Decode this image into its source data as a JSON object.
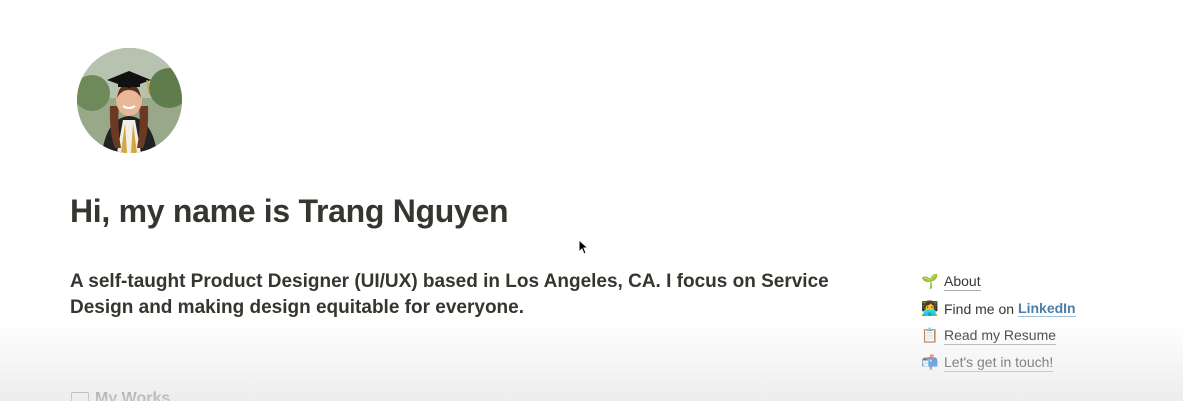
{
  "profile": {
    "avatar_icon": "graduate-photo"
  },
  "header": {
    "title": "Hi, my name is Trang Nguyen"
  },
  "intro": {
    "text": "A self-taught Product Designer (UI/UX) based in Los Angeles, CA. I focus on Service Design and making design equitable for everyone."
  },
  "side_links": [
    {
      "emoji": "🌱",
      "label": "About"
    },
    {
      "emoji": "👩‍💻",
      "prefix": "Find me on",
      "link": "LinkedIn"
    },
    {
      "emoji": "📋",
      "label": "Read my Resume"
    },
    {
      "emoji": "📬",
      "label": "Let's get in touch!"
    }
  ],
  "sections": {
    "works_heading": "My Works",
    "works_icon": "window-icon"
  },
  "colors": {
    "text": "#37352f",
    "link_blue": "#4a7fa8",
    "background": "#ffffff"
  }
}
